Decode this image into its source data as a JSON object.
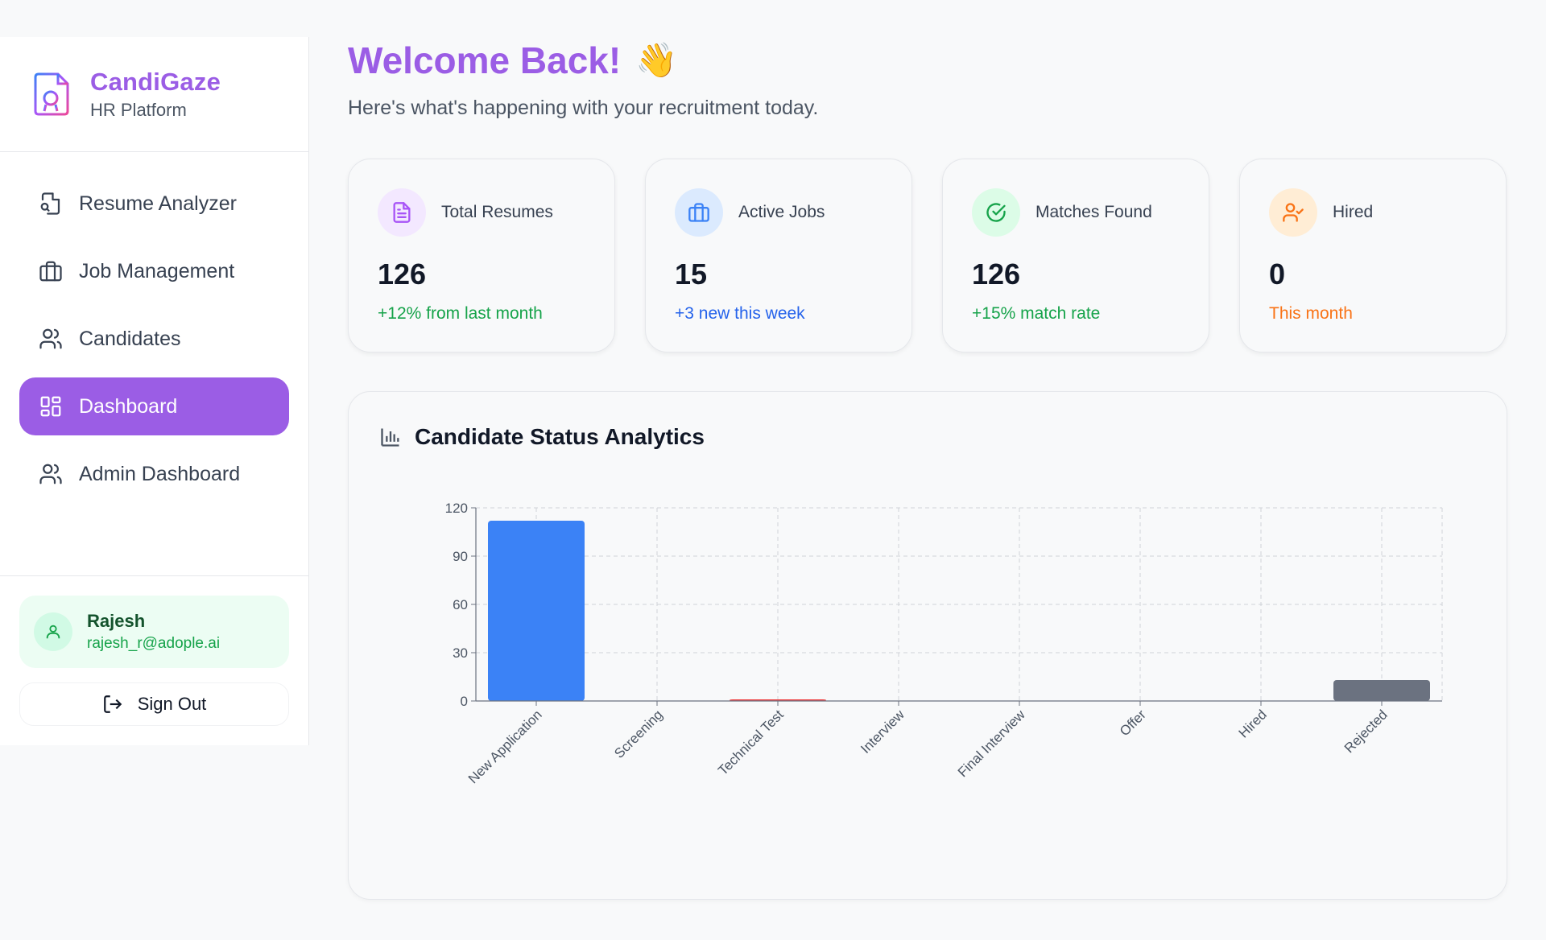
{
  "brand": {
    "title": "CandiGaze",
    "subtitle": "HR Platform",
    "color": "#9b5de5"
  },
  "nav": {
    "items": [
      {
        "label": "Resume Analyzer",
        "icon": "file-search-icon",
        "active": false
      },
      {
        "label": "Job Management",
        "icon": "briefcase-icon",
        "active": false
      },
      {
        "label": "Candidates",
        "icon": "users-icon",
        "active": false
      },
      {
        "label": "Dashboard",
        "icon": "dashboard-icon",
        "active": true
      },
      {
        "label": "Admin Dashboard",
        "icon": "users-icon",
        "active": false
      }
    ]
  },
  "user": {
    "name": "Rajesh",
    "email": "rajesh_r@adople.ai",
    "icon": "user-icon"
  },
  "signout": {
    "label": "Sign Out",
    "icon": "sign-out-icon"
  },
  "header": {
    "title": "Welcome Back!",
    "emoji": "👋",
    "subtitle": "Here's what's happening with your recruitment today."
  },
  "stats": [
    {
      "label": "Total Resumes",
      "value": "126",
      "note": "+12% from last month",
      "icon": "file-text-icon",
      "icon_color": "#a855f7",
      "icon_bg": "#f3e8ff",
      "note_color": "#16a34a"
    },
    {
      "label": "Active Jobs",
      "value": "15",
      "note": "+3 new this week",
      "icon": "briefcase-icon",
      "icon_color": "#3b82f6",
      "icon_bg": "#dbeafe",
      "note_color": "#2563eb"
    },
    {
      "label": "Matches Found",
      "value": "126",
      "note": "+15% match rate",
      "icon": "check-circle-icon",
      "icon_color": "#16a34a",
      "icon_bg": "#dcfce7",
      "note_color": "#16a34a"
    },
    {
      "label": "Hired",
      "value": "0",
      "note": "This month",
      "icon": "user-check-icon",
      "icon_color": "#f97316",
      "icon_bg": "#ffedd5",
      "note_color": "#f97316"
    }
  ],
  "chart_section": {
    "title": "Candidate Status Analytics",
    "icon": "bar-chart-icon"
  },
  "chart_data": {
    "type": "bar",
    "title": "",
    "xlabel": "",
    "ylabel": "",
    "categories": [
      "New Application",
      "Screening",
      "Technical Test",
      "Interview",
      "Final Interview",
      "Offer",
      "Hired",
      "Rejected"
    ],
    "values": [
      112,
      0,
      1,
      0,
      0,
      0,
      0,
      13
    ],
    "colors": [
      "#3b82f6",
      "#a855f7",
      "#ef4444",
      "#f59e0b",
      "#10b981",
      "#22c55e",
      "#16a34a",
      "#6b7280"
    ],
    "ylim": [
      0,
      120
    ],
    "yticks": [
      0,
      30,
      60,
      90,
      120
    ],
    "grid": true,
    "legend": "none"
  }
}
